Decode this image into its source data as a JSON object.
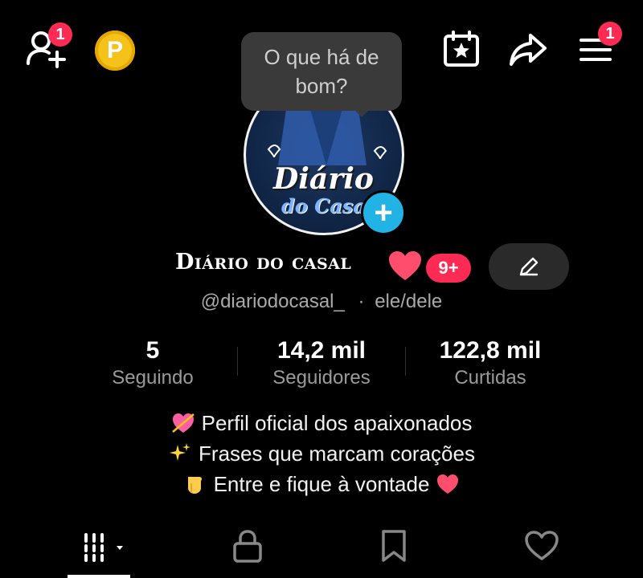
{
  "header": {
    "add_friend_badge": "1",
    "coin_label": "P",
    "menu_badge": "1",
    "tooltip": "O que há de bom?"
  },
  "profile": {
    "avatar_text_main": "Diário",
    "avatar_text_sub": "do Casal",
    "display_name": "Diário do casal",
    "notifications_pill": "9+",
    "handle": "@diariodocasal_",
    "pronouns_sep": "·",
    "pronouns": "ele/dele"
  },
  "stats": [
    {
      "value": "5",
      "label": "Seguindo"
    },
    {
      "value": "14,2 mil",
      "label": "Seguidores"
    },
    {
      "value": "122,8 mil",
      "label": "Curtidas"
    }
  ],
  "bio": {
    "line1": "Perfil oficial dos apaixonados",
    "line2": "Frases que marcam corações",
    "line3": "Entre e fique à vontade"
  },
  "icons": {
    "add_friend": "add-friend-icon",
    "coin": "coin-icon",
    "calendar": "calendar-star-icon",
    "share": "share-icon",
    "menu": "menu-icon",
    "edit": "pencil-icon",
    "tab_grid": "grid-icon",
    "tab_lock": "lock-icon",
    "tab_saved": "bookmark-icon",
    "tab_liked": "heart-icon"
  },
  "colors": {
    "background": "#000000",
    "badge": "#ff2b55",
    "plus": "#22b3e6",
    "coin": "#f5c21a"
  }
}
